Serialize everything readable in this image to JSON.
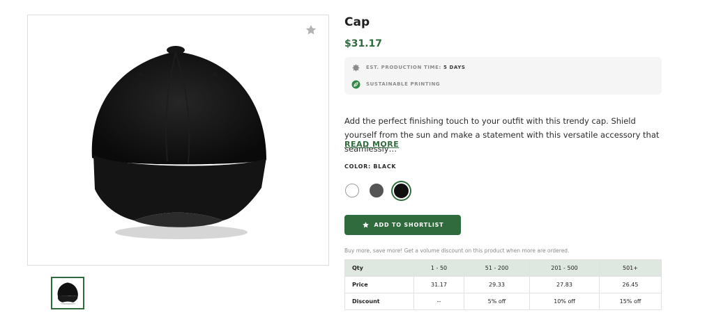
{
  "product": {
    "title": "Cap",
    "price": "$31.17",
    "image_alt": "Black cap",
    "favorite_icon": "star-icon"
  },
  "info": {
    "production_label": "EST. PRODUCTION TIME:",
    "production_value": "5 DAYS",
    "production_icon": "gear-icon",
    "sustainable_label": "SUSTAINABLE PRINTING",
    "sustainable_icon": "leaf-icon"
  },
  "description": {
    "text": "Add the perfect finishing touch to your outfit with this trendy cap. Shield yourself from the sun and make a statement with this versatile accessory that seamlessly…",
    "read_more": "READ MORE"
  },
  "color": {
    "label": "COLOR: BLACK",
    "options": [
      {
        "name": "White",
        "hex": "#ffffff"
      },
      {
        "name": "Grey",
        "hex": "#555555"
      },
      {
        "name": "Black",
        "hex": "#0f0f0f",
        "selected": true
      }
    ]
  },
  "actions": {
    "shortlist_label": "ADD TO SHORTLIST",
    "shortlist_icon": "star-icon"
  },
  "volume": {
    "note": "Buy more, save more! Get a volume discount on this product when more are ordered.",
    "headers": [
      "Qty",
      "1 - 50",
      "51 - 200",
      "201 - 500",
      "501+"
    ],
    "rows": [
      [
        "Price",
        "31.17",
        "29.33",
        "27.83",
        "26.45"
      ],
      [
        "Discount",
        "--",
        "5% off",
        "10% off",
        "15% off"
      ]
    ]
  },
  "colors": {
    "accent": "#2f6b3c",
    "table_header_bg": "#dfe7e1",
    "info_bg": "#f5f5f5"
  }
}
